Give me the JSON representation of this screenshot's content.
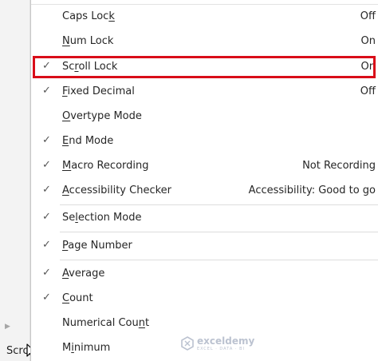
{
  "status_bar": {
    "partial_text": "Scro"
  },
  "watermark": {
    "name": "exceldemy",
    "tagline": "EXCEL · DATA · BI"
  },
  "menu": {
    "items": [
      {
        "text": "Caps Lock",
        "ul_index": 8,
        "value": "Off",
        "checked": false
      },
      {
        "text": "Num Lock",
        "ul_index": 0,
        "value": "On",
        "checked": false
      },
      {
        "text": "Scroll Lock",
        "ul_index": 2,
        "value": "On",
        "checked": true
      },
      {
        "text": "Fixed Decimal",
        "ul_index": 0,
        "value": "Off",
        "checked": true
      },
      {
        "text": "Overtype Mode",
        "ul_index": 0,
        "value": "",
        "checked": false
      },
      {
        "text": "End Mode",
        "ul_index": 0,
        "value": "",
        "checked": true
      },
      {
        "text": "Macro Recording",
        "ul_index": 0,
        "value": "Not Recording",
        "checked": true
      },
      {
        "text": "Accessibility Checker",
        "ul_index": 0,
        "value": "Accessibility: Good to go",
        "checked": true
      },
      {
        "text": "Selection Mode",
        "ul_index": 2,
        "value": "",
        "checked": true
      },
      {
        "text": "Page Number",
        "ul_index": 0,
        "value": "",
        "checked": true
      },
      {
        "text": "Average",
        "ul_index": 0,
        "value": "",
        "checked": true
      },
      {
        "text": "Count",
        "ul_index": 0,
        "value": "",
        "checked": true
      },
      {
        "text": "Numerical Count",
        "ul_index": 13,
        "value": "",
        "checked": false
      },
      {
        "text": "Minimum",
        "ul_index": 1,
        "value": "",
        "checked": false
      }
    ]
  },
  "icons": {
    "check": "checkmark-icon",
    "arrow": "scroll-right-arrow-icon",
    "cursor": "mouse-pointer-icon"
  }
}
